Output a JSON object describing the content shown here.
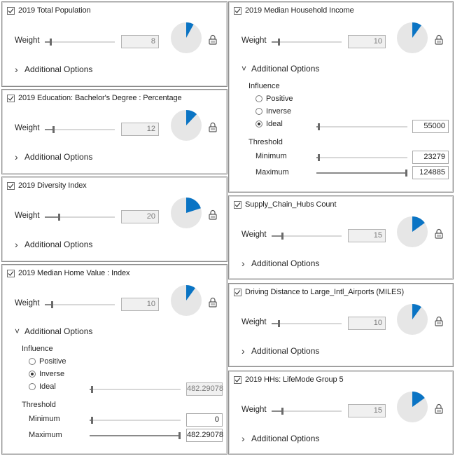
{
  "accent_color": "#0a74c4",
  "labels": {
    "weight": "Weight",
    "additional_options": "Additional Options",
    "influence": "Influence",
    "positive": "Positive",
    "inverse": "Inverse",
    "ideal": "Ideal",
    "threshold": "Threshold",
    "minimum": "Minimum",
    "maximum": "Maximum"
  },
  "criteria": [
    {
      "title": "2019 Total Population",
      "checked": true,
      "weight": "8",
      "weight_pct": 8,
      "expanded": false
    },
    {
      "title": "2019 Education: Bachelor's Degree : Percentage",
      "checked": true,
      "weight": "12",
      "weight_pct": 12,
      "expanded": false
    },
    {
      "title": "2019 Diversity Index",
      "checked": true,
      "weight": "20",
      "weight_pct": 20,
      "expanded": false
    },
    {
      "title": "2019 Median Home Value : Index",
      "checked": true,
      "weight": "10",
      "weight_pct": 10,
      "expanded": true,
      "influence": "Inverse",
      "ideal_value": "482.29078",
      "ideal_enabled": false,
      "ideal_pct": 0,
      "minimum": "0",
      "minimum_pct": 0,
      "maximum": "482.29078",
      "maximum_pct": 100
    },
    {
      "title": "2019 Median Household Income",
      "checked": true,
      "weight": "10",
      "weight_pct": 10,
      "expanded": true,
      "influence": "Ideal",
      "ideal_value": "55000",
      "ideal_enabled": true,
      "ideal_pct": 0,
      "minimum": "23279",
      "minimum_pct": 0,
      "maximum": "124885",
      "maximum_pct": 100
    },
    {
      "title": "Supply_Chain_Hubs Count",
      "checked": true,
      "weight": "15",
      "weight_pct": 15,
      "expanded": false
    },
    {
      "title": "Driving Distance to Large_Intl_Airports (MILES)",
      "checked": true,
      "weight": "10",
      "weight_pct": 10,
      "expanded": false
    },
    {
      "title": "2019 HHs: LifeMode Group 5",
      "checked": true,
      "weight": "15",
      "weight_pct": 15,
      "expanded": false
    }
  ]
}
